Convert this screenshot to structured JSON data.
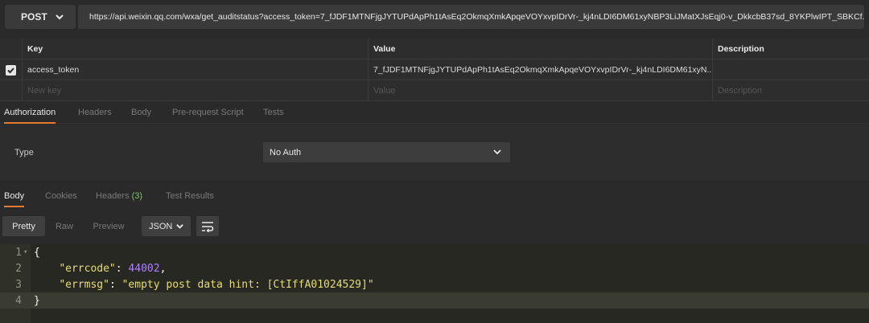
{
  "request": {
    "method": "POST",
    "url": "https://api.weixin.qq.com/wxa/get_auditstatus?access_token=7_fJDF1MTNFjgJYTUPdApPh1tAsEq2OkmqXmkApqeVOYxvpIDrVr-_kj4nLDI6DM61xyNBP3LiJMatXJsEqj0-v_DkkcbB37sd_8YKPlwIPT_SBKCf..."
  },
  "params": {
    "headers": {
      "key": "Key",
      "value": "Value",
      "description": "Description"
    },
    "rows": [
      {
        "checked": true,
        "key": "access_token",
        "value": "7_fJDF1MTNFjgJYTUPdApPh1tAsEq2OkmqXmkApqeVOYxvpIDrVr-_kj4nLDI6DM61xyN..."
      }
    ],
    "placeholder": {
      "key": "New key",
      "value": "Value",
      "description": "Description"
    }
  },
  "request_tabs": [
    "Authorization",
    "Headers",
    "Body",
    "Pre-request Script",
    "Tests"
  ],
  "auth": {
    "type_label": "Type",
    "type_value": "No Auth"
  },
  "response_tabs": {
    "body": "Body",
    "cookies": "Cookies",
    "headers": "Headers",
    "headers_count": "(3)",
    "tests": "Test Results"
  },
  "view_modes": {
    "pretty": "Pretty",
    "raw": "Raw",
    "preview": "Preview",
    "format": "JSON"
  },
  "response_lines": {
    "n1": "1",
    "n2": "2",
    "n3": "3",
    "n4": "4",
    "open": "{",
    "errcode_key": "\"errcode\"",
    "errcode_val": "44002",
    "errmsg_key": "\"errmsg\"",
    "errmsg_val": "\"empty post data hint: [CtIffA01024529]\"",
    "close": "}"
  },
  "colors": {
    "accent": "#e87a32",
    "count_green": "#7cc36e",
    "json_key": "#e6db74",
    "json_number": "#ae81ff"
  },
  "icons": {
    "method_dropdown": "chevron-down-icon",
    "check": "check-icon",
    "wrap": "wrap-lines-icon"
  }
}
